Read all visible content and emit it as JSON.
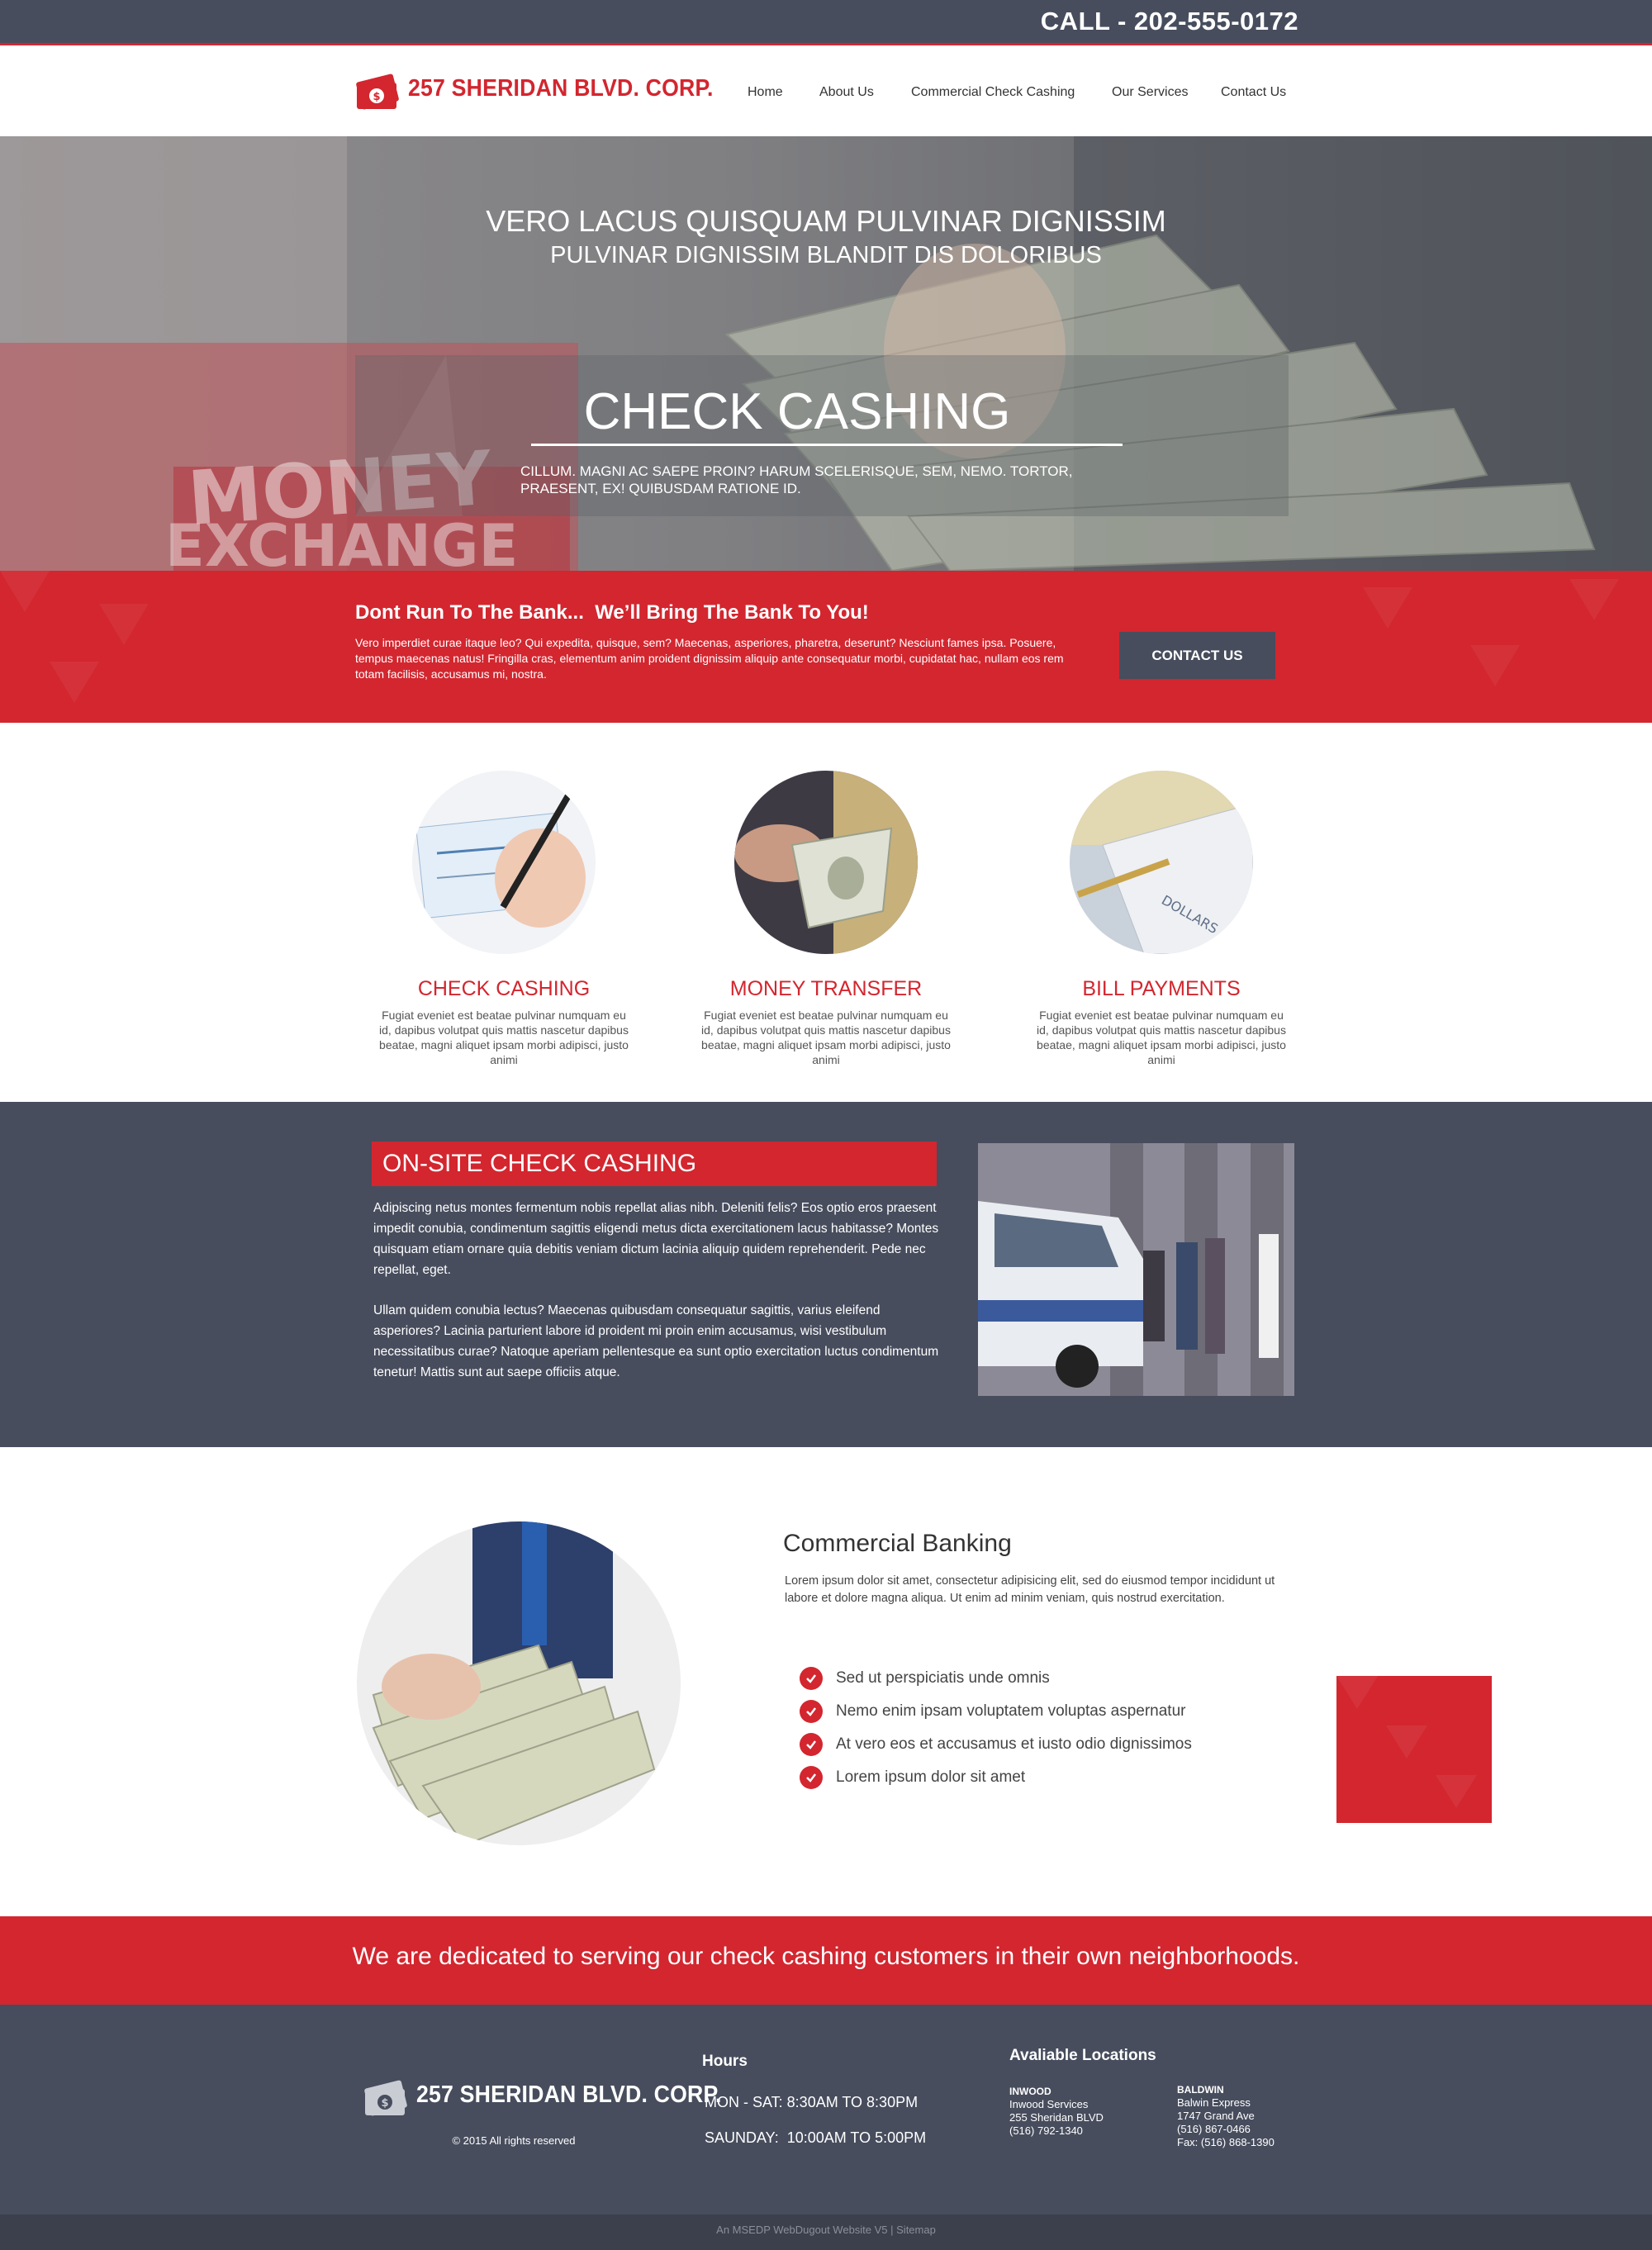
{
  "topbar": {
    "call": "CALL - 202-555-0172"
  },
  "brand": {
    "name": "257 SHERIDAN BLVD. CORP."
  },
  "nav": {
    "items": [
      "Home",
      "About Us",
      "Commercial Check Cashing",
      "Our Services",
      "Contact Us"
    ]
  },
  "hero": {
    "heading": "VERO LACUS QUISQUAM PULVINAR DIGNISSIM",
    "subheading": "PULVINAR DIGNISSIM BLANDIT DIS DOLORIBUS",
    "title": "CHECK CASHING",
    "text": "CILLUM. MAGNI AC SAEPE PROIN? HARUM SCELERISQUE, SEM, NEMO. TORTOR, PRAESENT, EX! QUIBUSDAM RATIONE ID."
  },
  "cta": {
    "heading": "Dont Run To The Bank...  We’ll Bring The Bank To You!",
    "text": "Vero imperdiet curae itaque leo? Qui expedita, quisque, sem? Maecenas, asperiores, pharetra, deserunt? Nesciunt fames ipsa. Posuere, tempus maecenas natus! Fringilla cras, elementum anim proident dignissim aliquip ante consequatur morbi, cupidatat hac, nullam eos rem totam facilisis, accusamus mi, nostra.",
    "button": "CONTACT US"
  },
  "services": [
    {
      "title": "CHECK CASHING",
      "text": "Fugiat eveniet est beatae pulvinar numquam eu id, dapibus volutpat quis mattis nascetur dapibus beatae, magni aliquet ipsam morbi adipisci, justo animi"
    },
    {
      "title": "MONEY TRANSFER",
      "text": "Fugiat eveniet est beatae pulvinar numquam eu id, dapibus volutpat quis mattis nascetur dapibus beatae, magni aliquet ipsam morbi adipisci, justo animi"
    },
    {
      "title": "BILL PAYMENTS",
      "text": "Fugiat eveniet est beatae pulvinar numquam eu id, dapibus volutpat quis mattis nascetur dapibus beatae, magni aliquet ipsam morbi adipisci, justo animi"
    }
  ],
  "onsite": {
    "title": "ON-SITE CHECK CASHING",
    "para1": "Adipiscing netus montes fermentum nobis repellat alias nibh. Deleniti felis? Eos optio eros praesent impedit conubia, condimentum sagittis eligendi metus dicta exercitationem lacus habitasse? Montes quisquam etiam ornare quia debitis veniam dictum lacinia aliquip quidem reprehenderit. Pede nec repellat, eget.",
    "para2": "Ullam quidem conubia lectus? Maecenas quibusdam consequatur sagittis, varius eleifend asperiores? Lacinia parturient labore id proident mi proin enim accusamus, wisi vestibulum necessitatibus curae? Natoque aperiam pellentesque ea sunt optio exercitation luctus condimentum tenetur! Mattis sunt aut saepe officiis atque."
  },
  "commercial": {
    "title": "Commercial Banking",
    "text": "Lorem ipsum dolor sit amet, consectetur adipisicing elit, sed do eiusmod tempor incididunt ut labore et dolore magna aliqua. Ut enim ad minim veniam, quis nostrud exercitation.",
    "items": [
      "Sed ut perspiciatis unde omnis",
      "Nemo enim ipsam voluptatem voluptas aspernatur",
      "At vero eos et accusamus et iusto odio dignissimos",
      "Lorem ipsum dolor sit amet"
    ]
  },
  "tagline": "We are dedicated to serving our check cashing customers in their own neighborhoods.",
  "footer": {
    "copyright": "© 2015 All rights reserved",
    "hours_title": "Hours",
    "hours_weekday": "MON - SAT: 8:30AM TO 8:30PM",
    "hours_sunday": "SAUNDAY:  10:00AM TO 5:00PM",
    "locations_title": "Avaliable Locations",
    "locations": [
      {
        "name": "INWOOD",
        "lines": [
          "Inwood Services",
          "255 Sheridan BLVD",
          "(516) 792-1340"
        ]
      },
      {
        "name": "BALDWIN",
        "lines": [
          "Balwin Express",
          "1747 Grand Ave",
          "(516) 867-0466",
          "Fax: (516) 868-1390"
        ]
      }
    ],
    "bottom": "An MSEDP WebDugout Website V5  |  Sitemap"
  },
  "colors": {
    "accent": "#d3262f",
    "dark": "#474d5d",
    "bottombar": "#3b404c"
  }
}
